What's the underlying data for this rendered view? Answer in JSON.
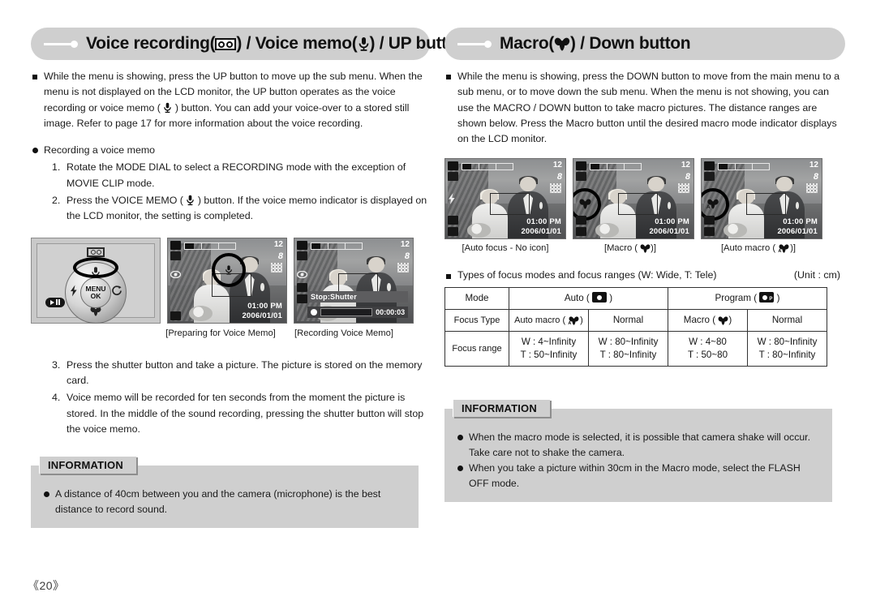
{
  "page": {
    "number": "《20》"
  },
  "left": {
    "header": {
      "prefix": "Voice recording(",
      "mid": ") / Voice memo(",
      "suffix": ") / UP button",
      "icon1": "voice-recording-tape-icon",
      "icon2": "microphone-icon"
    },
    "intro": "While the menu is showing, press the UP button to move up the sub menu. When the menu is not displayed on the LCD monitor, the UP button operates as the voice recording or voice memo (  ) button. You can add your voice-over to a stored still image. Refer to page 17 for more information about the voice recording.",
    "intro_part1": "While the menu is showing, press the UP button to move up the sub menu. When the menu is not displayed on the LCD monitor, the UP button operates as the voice recording or voice memo (",
    "intro_part2": ") button. You can add your voice-over to a stored still image. Refer to page 17 for more information about the voice recording.",
    "subheading": "Recording a voice memo",
    "steps": [
      {
        "num": "1.",
        "text": "Rotate the MODE DIAL to select a RECORDING mode with the exception of MOVIE CLIP mode."
      },
      {
        "num": "2.",
        "text_part1": "Press the VOICE MEMO (",
        "text_part2": ") button. If the voice memo indicator is displayed on the LCD monitor, the setting is completed."
      },
      {
        "num": "3.",
        "text": "Press the shutter button and take a picture. The picture is stored on the memory card."
      },
      {
        "num": "4.",
        "text": "Voice memo will be recorded for ten seconds from the moment the picture is stored. In the middle of the sound recording, pressing the shutter button will stop the voice memo."
      }
    ],
    "dial": {
      "center_line1": "MENU",
      "center_line2": "OK",
      "up_icon": "microphone-icon",
      "down_icon": "macro-flower-icon",
      "left_icon": "flash-icon",
      "right_icon": "self-timer-icon",
      "top_icon": "voice-recording-tape-icon",
      "play_icon": "play-pause-icon"
    },
    "lcd_prepare": {
      "count": "12",
      "size": "8",
      "time": "01:00 PM",
      "date": "2006/01/01",
      "indicator_icon": "voice-memo-indicator-icon"
    },
    "lcd_recording": {
      "count": "12",
      "size": "8",
      "banner": "Stop:Shutter",
      "timecode": "00:00:03"
    },
    "captions": [
      "[Preparing for Voice Memo]",
      "[Recording Voice Memo]"
    ],
    "information": {
      "title": "INFORMATION",
      "items": [
        "A distance of 40cm between you and the camera (microphone) is the best distance to record sound."
      ]
    }
  },
  "right": {
    "header": {
      "prefix": "Macro(",
      "suffix": ") / Down button",
      "icon": "macro-flower-icon"
    },
    "intro": "While the menu is showing, press the DOWN button to move from the main menu to a sub menu, or to move down the sub menu. When the menu is not showing, you can use the MACRO / DOWN button to take macro pictures. The distance ranges are shown below. Press the Macro button until the desired macro mode indicator displays on the LCD monitor.",
    "lcds": [
      {
        "count": "12",
        "size": "8",
        "time": "01:00 PM",
        "date": "2006/01/01",
        "mode_icon": "none"
      },
      {
        "count": "12",
        "size": "8",
        "time": "01:00 PM",
        "date": "2006/01/01",
        "mode_icon": "macro-flower-icon"
      },
      {
        "count": "12",
        "size": "8",
        "time": "01:00 PM",
        "date": "2006/01/01",
        "mode_icon": "auto-macro-icon"
      }
    ],
    "captions": [
      {
        "pre": "[Auto focus - No icon]",
        "icon": "none",
        "post": ""
      },
      {
        "pre": "[Macro (",
        "icon": "macro-flower-icon",
        "post": ")]"
      },
      {
        "pre": "[Auto macro (",
        "icon": "auto-macro-icon",
        "post": ")]"
      }
    ],
    "table_caption": "Types of focus modes and focus ranges (W: Wide, T: Tele)",
    "unit": "(Unit : cm)",
    "table": {
      "row_labels": [
        "Mode",
        "Focus Type",
        "Focus range"
      ],
      "modes": [
        {
          "label_pre": "Auto (",
          "label_post": ")",
          "icon": "auto-mode-icon",
          "colspan": 2
        },
        {
          "label_pre": "Program (",
          "label_post": ")",
          "icon": "program-mode-icon",
          "colspan": 2
        }
      ],
      "focus_types": [
        {
          "pre": "Auto macro (",
          "icon": "auto-macro-icon",
          "post": ")"
        },
        {
          "pre": "Normal",
          "icon": "none",
          "post": ""
        },
        {
          "pre": "Macro (",
          "icon": "macro-flower-icon",
          "post": ")"
        },
        {
          "pre": "Normal",
          "icon": "none",
          "post": ""
        }
      ],
      "focus_ranges": [
        {
          "w": "W : 4~Infinity",
          "t": "T : 50~Infinity"
        },
        {
          "w": "W : 80~Infinity",
          "t": "T : 80~Infinity"
        },
        {
          "w": "W : 4~80",
          "t": "T : 50~80"
        },
        {
          "w": "W : 80~Infinity",
          "t": "T : 80~Infinity"
        }
      ]
    },
    "information": {
      "title": "INFORMATION",
      "items": [
        "When the macro mode is selected, it is possible that camera shake will occur. Take care not to shake the camera.",
        "When you take a picture within 30cm in the Macro mode, select the FLASH OFF mode."
      ]
    }
  },
  "colors": {
    "header_bg": "#cfcfcf",
    "info_bg": "#cfcfcf",
    "text": "#1a1a1a"
  }
}
